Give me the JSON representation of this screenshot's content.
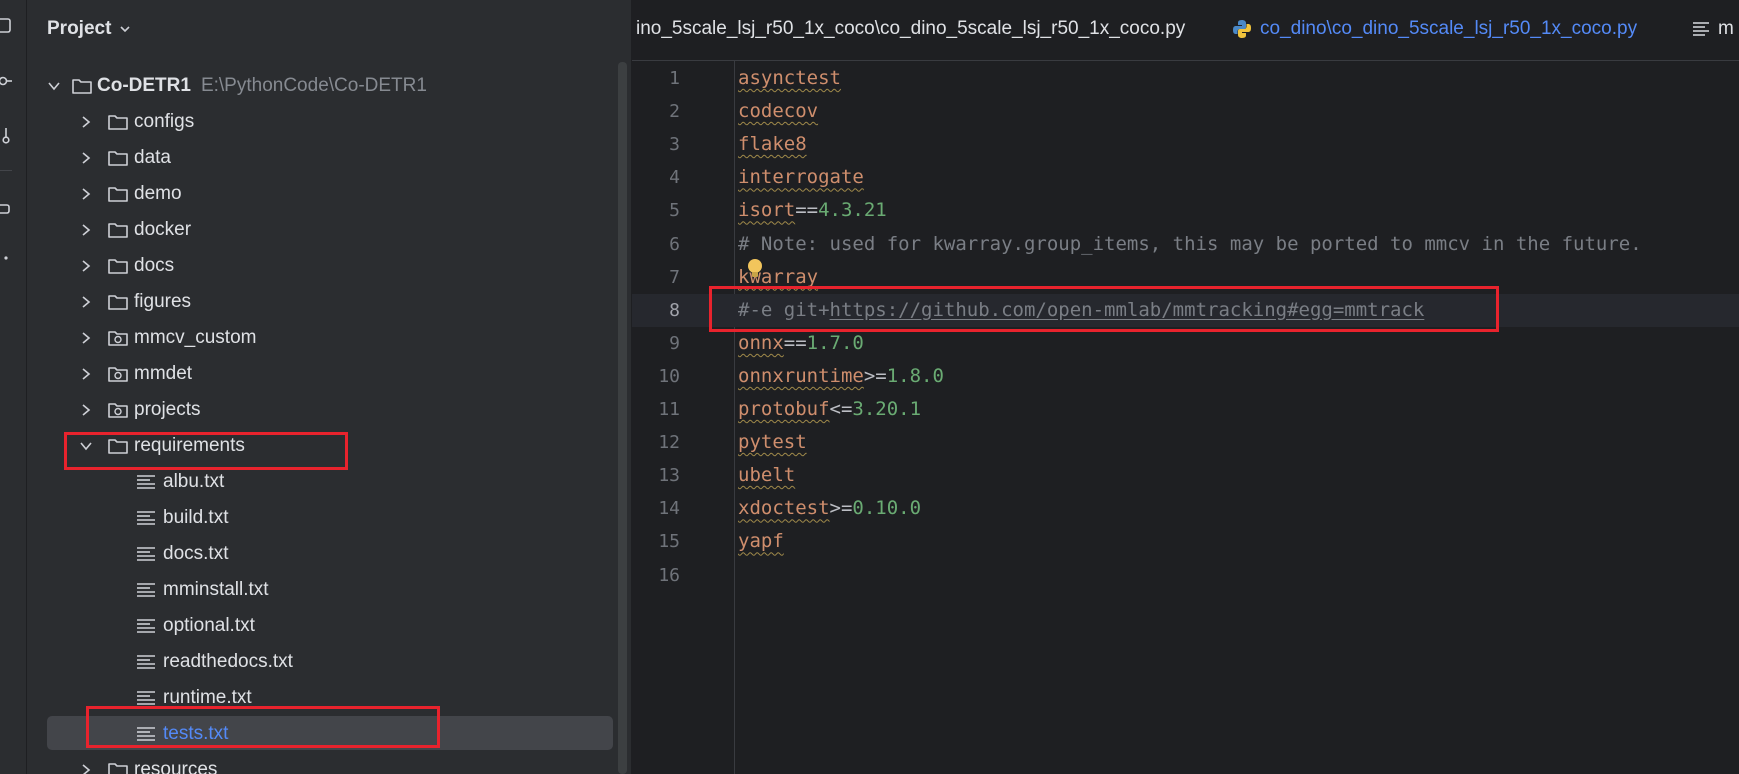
{
  "project_panel": {
    "title": "Project",
    "root": {
      "name": "Co-DETR1",
      "path": "E:\\PythonCode\\Co-DETR1"
    },
    "folders": [
      {
        "name": "configs",
        "icon": "folder-icon"
      },
      {
        "name": "data",
        "icon": "folder-icon"
      },
      {
        "name": "demo",
        "icon": "folder-icon"
      },
      {
        "name": "docker",
        "icon": "folder-icon"
      },
      {
        "name": "docs",
        "icon": "folder-icon"
      },
      {
        "name": "figures",
        "icon": "folder-icon"
      },
      {
        "name": "mmcv_custom",
        "icon": "package-folder-icon"
      },
      {
        "name": "mmdet",
        "icon": "package-folder-icon"
      },
      {
        "name": "projects",
        "icon": "package-folder-icon"
      },
      {
        "name": "requirements",
        "icon": "folder-icon"
      }
    ],
    "requirements_files": [
      "albu.txt",
      "build.txt",
      "docs.txt",
      "mminstall.txt",
      "optional.txt",
      "readthedocs.txt",
      "runtime.txt",
      "tests.txt"
    ],
    "selected_file": "tests.txt",
    "next_folder": "resources"
  },
  "tabs": [
    {
      "label": "ino_5scale_lsj_r50_1x_coco\\co_dino_5scale_lsj_r50_1x_coco.py"
    },
    {
      "label": "co_dino\\co_dino_5scale_lsj_r50_1x_coco.py",
      "icon": "python-icon"
    },
    {
      "label": "m",
      "icon": "text-file-icon"
    }
  ],
  "editor": {
    "current_line": 8,
    "lines": [
      {
        "n": "1",
        "pkg": "asynctest"
      },
      {
        "n": "2",
        "pkg": "codecov"
      },
      {
        "n": "3",
        "pkg": "flake8"
      },
      {
        "n": "4",
        "pkg": "interrogate"
      },
      {
        "n": "5",
        "pkg": "isort",
        "op": "==",
        "ver": "4.3.21"
      },
      {
        "n": "6",
        "comment": "# Note: used for kwarray.group_items, this may be ported to mmcv in the future."
      },
      {
        "n": "7",
        "pkg": "kwarray"
      },
      {
        "n": "8",
        "comment": "#-e git+",
        "url": "https://github.com/open-mmlab/mmtracking#egg=mmtrack"
      },
      {
        "n": "9",
        "pkg": "onnx",
        "op": "==",
        "ver": "1.7.0"
      },
      {
        "n": "10",
        "pkg": "onnxruntime",
        "op": ">=",
        "ver": "1.8.0"
      },
      {
        "n": "11",
        "pkg": "protobuf",
        "op": "<=",
        "ver": "3.20.1"
      },
      {
        "n": "12",
        "pkg": "pytest"
      },
      {
        "n": "13",
        "pkg": "ubelt"
      },
      {
        "n": "14",
        "pkg": "xdoctest",
        "op": ">=",
        "ver": "0.10.0"
      },
      {
        "n": "15",
        "pkg": "yapf"
      },
      {
        "n": "16"
      }
    ]
  },
  "colors": {
    "highlight_box": "#e8232d",
    "selected_text": "#548af7",
    "package": "#cf8e6d",
    "version": "#6aab73",
    "comment": "#7a7e85"
  }
}
